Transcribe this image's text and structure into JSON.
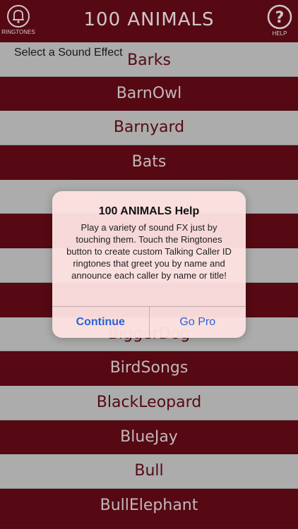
{
  "header": {
    "title": "100 ANIMALS",
    "ringtones_label": "RINGTONES",
    "help_label": "HELP",
    "ringtones_icon": "bell-icon",
    "help_icon": "question-circle-icon"
  },
  "list": {
    "subtitle": "Select a Sound Effect",
    "items": [
      "Barks",
      "BarnOwl",
      "Barnyard",
      "Bats",
      "",
      "",
      "",
      "",
      "BiggerDog",
      "BirdSongs",
      "BlackLeopard",
      "BlueJay",
      "Bull",
      "BullElephant"
    ]
  },
  "dialog": {
    "title": "100 ANIMALS Help",
    "message": "Play a variety of sound FX just by touching them. Touch the Ringtones button to create custom Talking Caller ID ringtones that greet you by name and announce each caller by name or title!",
    "continue_label": "Continue",
    "gopro_label": "Go Pro"
  },
  "colors": {
    "dark_row": "#5a0a14",
    "light_row": "#b3b3b3",
    "dialog_button": "#2a62d6"
  }
}
